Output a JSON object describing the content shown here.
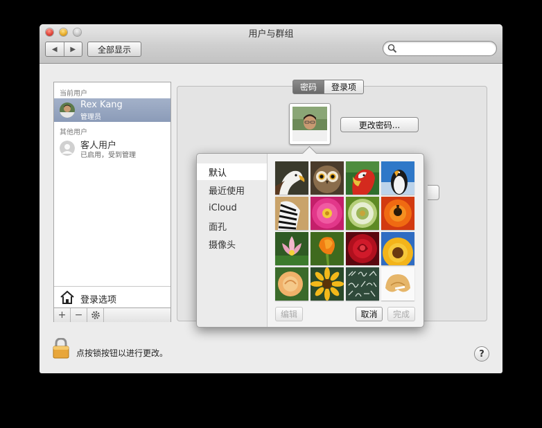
{
  "window": {
    "title": "用户与群组"
  },
  "toolbar": {
    "back_icon": "◀",
    "forward_icon": "▶",
    "show_all_label": "全部显示",
    "search_placeholder": "",
    "search_value": ""
  },
  "sidebar": {
    "current_users_label": "当前用户",
    "current_user": {
      "name": "Rex Kang",
      "role": "管理员"
    },
    "other_users_label": "其他用户",
    "guest_user": {
      "name": "客人用户",
      "status": "已启用，受到管理"
    },
    "login_options_label": "登录选项",
    "add_label": "+",
    "remove_label": "−",
    "gear_icon": "gear-icon"
  },
  "tabs": {
    "password": "密码",
    "login_items": "登录项"
  },
  "main": {
    "change_password_label": "更改密码..."
  },
  "popover": {
    "categories": [
      "默认",
      "最近使用",
      "iCloud",
      "面孔",
      "摄像头"
    ],
    "selected_category": "默认",
    "pictures": [
      "eagle",
      "owl",
      "parrot",
      "penguin",
      "zebra",
      "pink-flower",
      "dandelion",
      "orange-flower",
      "lotus",
      "orange-tulip",
      "red-rose",
      "sunflower",
      "yellow-rose",
      "yellow-daisy",
      "chalkboard",
      "fortune-cookie"
    ],
    "edit_label": "编辑",
    "cancel_label": "取消",
    "done_label": "完成"
  },
  "footer": {
    "lock_text": "点按锁按钮以进行更改。",
    "help_label": "?"
  }
}
